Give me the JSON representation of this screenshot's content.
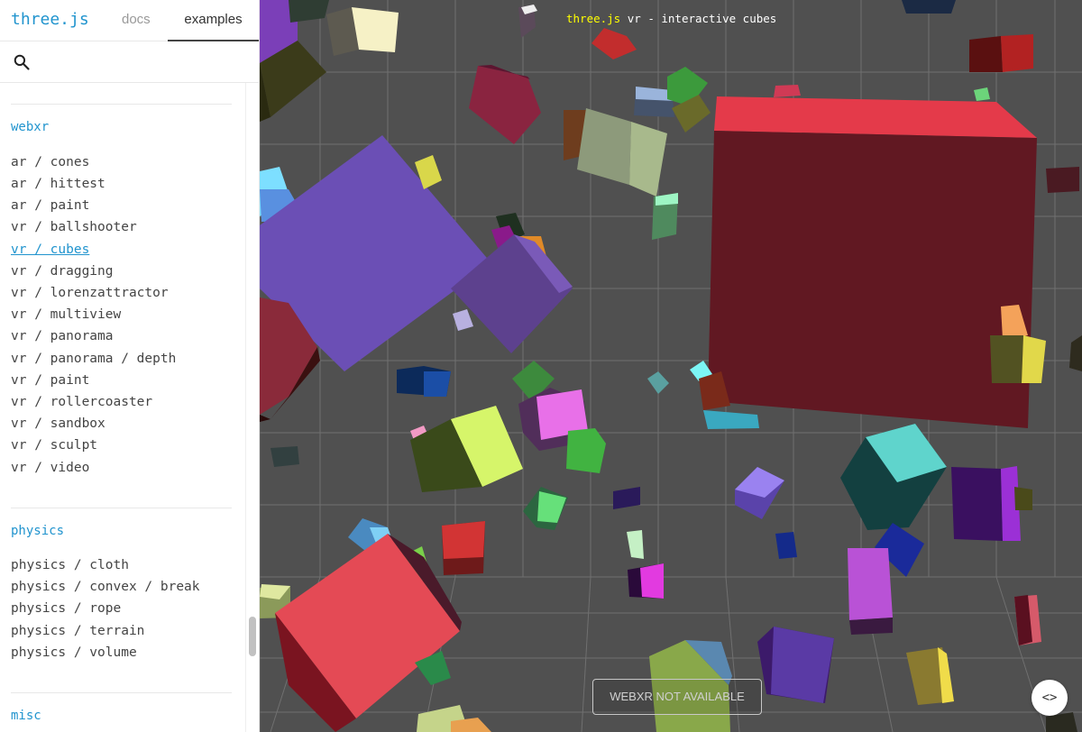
{
  "header": {
    "logo": "three.js",
    "tabs": [
      "docs",
      "examples"
    ]
  },
  "search": {
    "placeholder": ""
  },
  "sections": [
    {
      "title": "webxr",
      "items": [
        "ar / cones",
        "ar / hittest",
        "ar / paint",
        "vr / ballshooter",
        "vr / cubes",
        "vr / dragging",
        "vr / lorenzattractor",
        "vr / multiview",
        "vr / panorama",
        "vr / panorama / depth",
        "vr / paint",
        "vr / rollercoaster",
        "vr / sandbox",
        "vr / sculpt",
        "vr / video"
      ],
      "selected": "vr / cubes"
    },
    {
      "title": "physics",
      "items": [
        "physics / cloth",
        "physics / convex / break",
        "physics / rope",
        "physics / terrain",
        "physics / volume"
      ]
    },
    {
      "title": "misc",
      "items": []
    }
  ],
  "viewport": {
    "info_link": "three.js",
    "info_text": " vr - interactive cubes",
    "vr_button": "WEBXR NOT AVAILABLE",
    "source_button": "<>"
  },
  "colors": {
    "accent": "#2194ce",
    "background_3d": "#505050",
    "info_link": "#ffff00"
  }
}
